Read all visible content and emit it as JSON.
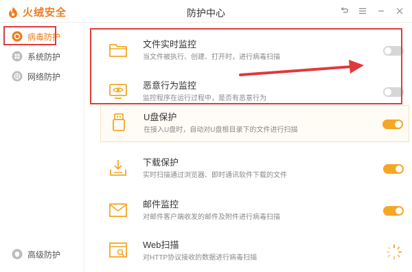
{
  "app": {
    "brand": "火绒安全",
    "window_title": "防护中心"
  },
  "sidebar": {
    "items": [
      {
        "label": "病毒防护",
        "icon": "shield-virus-icon",
        "active": true
      },
      {
        "label": "系统防护",
        "icon": "windows-icon",
        "active": false
      },
      {
        "label": "网络防护",
        "icon": "globe-icon",
        "active": false
      }
    ],
    "bottom_item": {
      "label": "高级防护",
      "icon": "advanced-shield-icon"
    }
  },
  "protections": [
    {
      "title": "文件实时监控",
      "desc": "当文件被执行、创建、打开时，进行病毒扫描",
      "icon": "folder-icon",
      "state": "off"
    },
    {
      "title": "恶意行为监控",
      "desc": "监控程序在运行过程中，是否有恶意行为",
      "icon": "monitor-eye-icon",
      "state": "off"
    },
    {
      "title": "U盘保护",
      "desc": "在接入U盘时，自动对U盘根目录下的文件进行扫描",
      "icon": "usb-drive-icon",
      "state": "on"
    },
    {
      "title": "下载保护",
      "desc": "实时扫描通过浏览器、即时通讯软件下载的文件",
      "icon": "download-icon",
      "state": "on"
    },
    {
      "title": "邮件监控",
      "desc": "对邮件客户端收发的邮件及附件进行病毒扫描",
      "icon": "mail-icon",
      "state": "on"
    },
    {
      "title": "Web扫描",
      "desc": "对HTTP协议接收的数据进行病毒扫描",
      "icon": "web-scan-icon",
      "state": "loading"
    }
  ],
  "colors": {
    "accent": "#f07b1d",
    "toggle_on": "#f5a623",
    "toggle_off": "#d7d7d7",
    "annotation_red": "#e0393b"
  }
}
